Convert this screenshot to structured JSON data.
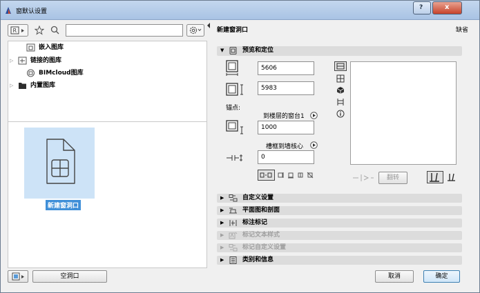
{
  "window": {
    "title": "窗默认设置",
    "help_glyph": "?",
    "close_glyph": "x"
  },
  "library": {
    "search": {
      "value": "",
      "placeholder": ""
    },
    "tree": [
      {
        "label": "嵌入图库",
        "expandable": false
      },
      {
        "label": "链接的图库",
        "expandable": true
      },
      {
        "label": "BIMcloud图库",
        "expandable": false
      },
      {
        "label": "内置图库",
        "expandable": true
      }
    ],
    "selected_item": "新建窗洞口",
    "empty_button": "空洞口"
  },
  "settings": {
    "title": "新建窗洞口",
    "selection_label": "缺省",
    "preview_section": {
      "title": "预览和定位",
      "width": "5606",
      "height": "5983",
      "anchor_label": "锚点:",
      "sill_ref": "到楼层的窗台1",
      "sill_value": "1000",
      "reveal_ref": "槽框到墙核心",
      "reveal_value": "0",
      "mirror_label": "翻转"
    },
    "sections": [
      {
        "label": "自定义设置",
        "enabled": true
      },
      {
        "label": "平面图和剖面",
        "enabled": true
      },
      {
        "label": "标注标记",
        "enabled": true
      },
      {
        "label": "标记文本样式",
        "enabled": false
      },
      {
        "label": "标记自定义设置",
        "enabled": false
      },
      {
        "label": "类别和信息",
        "enabled": true
      }
    ]
  },
  "buttons": {
    "cancel": "取消",
    "ok": "确定"
  },
  "colors": {
    "accent": "#3f8fd8",
    "selection_bg": "#cde3f7",
    "section_bg": "#dcdcdc",
    "title_bar": "#b7cde9"
  }
}
